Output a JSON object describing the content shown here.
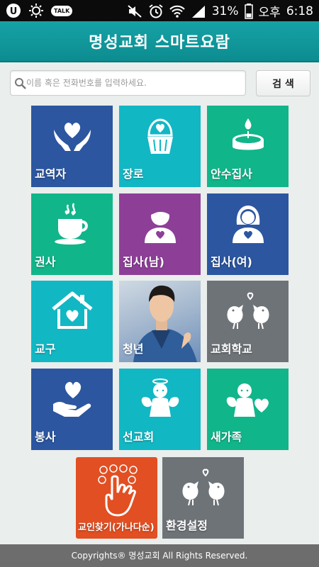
{
  "status_bar": {
    "battery": "31%",
    "ampm": "오후",
    "time": "6:18",
    "talk_badge": "TALK"
  },
  "header": {
    "title": "명성교회 스마트요람"
  },
  "search": {
    "placeholder": "이름 혹은 전화번호를 입력하세요.",
    "button_label": "검 색"
  },
  "tiles": [
    {
      "label": "교역자",
      "color": "#2c56a0",
      "icon": "hands-heart-icon"
    },
    {
      "label": "장로",
      "color": "#12b7c4",
      "icon": "cupcake-heart-icon"
    },
    {
      "label": "안수집사",
      "color": "#11b58a",
      "icon": "candle-icon"
    },
    {
      "label": "권사",
      "color": "#11b58a",
      "icon": "teacup-icon"
    },
    {
      "label": "집사(남)",
      "color": "#8d3f98",
      "icon": "man-heart-icon"
    },
    {
      "label": "집사(여)",
      "color": "#2c56a0",
      "icon": "woman-heart-icon"
    },
    {
      "label": "교구",
      "color": "#12b7c4",
      "icon": "house-heart-icon"
    },
    {
      "label": "청년",
      "color": "#8fb0d6",
      "icon": "young-man-photo"
    },
    {
      "label": "교회학교",
      "color": "#6e7378",
      "icon": "birds-icon"
    },
    {
      "label": "봉사",
      "color": "#2c56a0",
      "icon": "hand-heart-icon"
    },
    {
      "label": "선교회",
      "color": "#12b7c4",
      "icon": "angel-icon"
    },
    {
      "label": "새가족",
      "color": "#11b58a",
      "icon": "angel-heart-icon"
    },
    {
      "label": "교인찾기(가나다순)",
      "color": "#e24f22",
      "icon": "finger-touch-icon"
    },
    {
      "label": "환경설정",
      "color": "#6e7378",
      "icon": "birds-icon"
    }
  ],
  "footer": {
    "text": "Copyrights® 명성교회 All Rights Reserved."
  }
}
